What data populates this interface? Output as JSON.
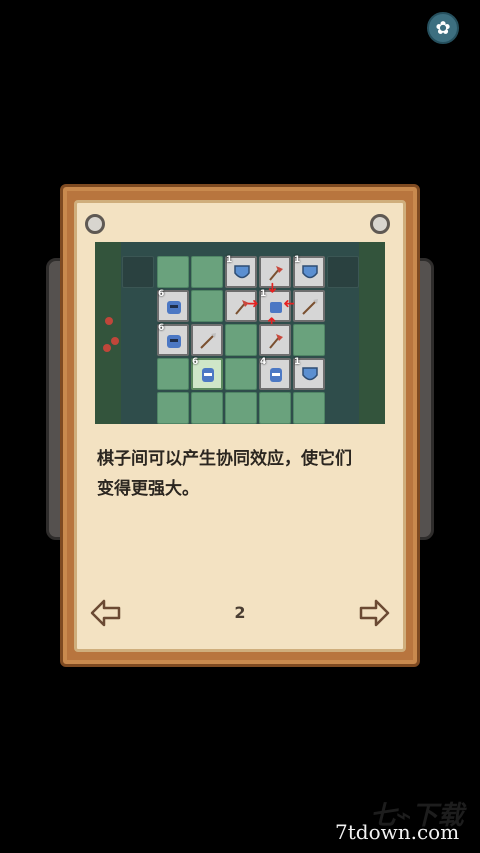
{
  "settings": {
    "icon": "gear-icon"
  },
  "tutorial": {
    "description_line1": "棋子间可以产生协同效应，使它们",
    "description_line2": "变得更强大。",
    "page_number": "2",
    "prev_icon": "arrow-left-icon",
    "next_icon": "arrow-right-icon"
  },
  "board": {
    "levels": {
      "shield_a": "1",
      "shield_b": "1",
      "blue_unit_a": "6",
      "blue_unit_b": "6",
      "knight_green": "6",
      "knight_gray": "4",
      "shield_c": "1",
      "center_unit": "1"
    }
  },
  "watermark": {
    "site": "7tdown.com"
  },
  "colors": {
    "frame": "#b8753e",
    "paper": "#f3e2c2",
    "tile_green": "#6aa27d",
    "synergy_arrow": "#e52222"
  }
}
